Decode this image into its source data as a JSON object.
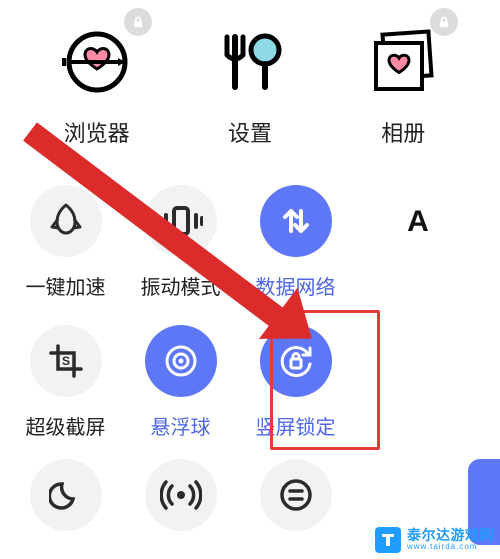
{
  "apps": [
    {
      "label": "浏览器",
      "icon": "heart-target-icon",
      "locked": true
    },
    {
      "label": "设置",
      "icon": "cutlery-icon",
      "locked": false
    },
    {
      "label": "相册",
      "icon": "gallery-heart-icon",
      "locked": true
    }
  ],
  "qs": {
    "row1": [
      {
        "label": "一键加速",
        "icon": "boost-icon",
        "active": false
      },
      {
        "label": "振动模式",
        "icon": "vibrate-icon",
        "active": false
      },
      {
        "label": "数据网络",
        "icon": "data-swap-icon",
        "active": true
      },
      {
        "label": "A",
        "icon": "font-size-icon",
        "plain": true
      }
    ],
    "row2": [
      {
        "label": "超级截屏",
        "icon": "screenshot-icon",
        "active": false
      },
      {
        "label": "悬浮球",
        "icon": "float-ball-icon",
        "active": true
      },
      {
        "label": "竖屏锁定",
        "icon": "rotation-lock-icon",
        "active": true,
        "highlighted": true
      }
    ],
    "row3": [
      {
        "icon": "moon-icon",
        "active": false
      },
      {
        "icon": "hotspot-icon",
        "active": false
      },
      {
        "icon": "list-icon",
        "active": false
      }
    ]
  },
  "watermark": {
    "title": "泰尔达游戏网",
    "url": "www.tairda.com"
  }
}
